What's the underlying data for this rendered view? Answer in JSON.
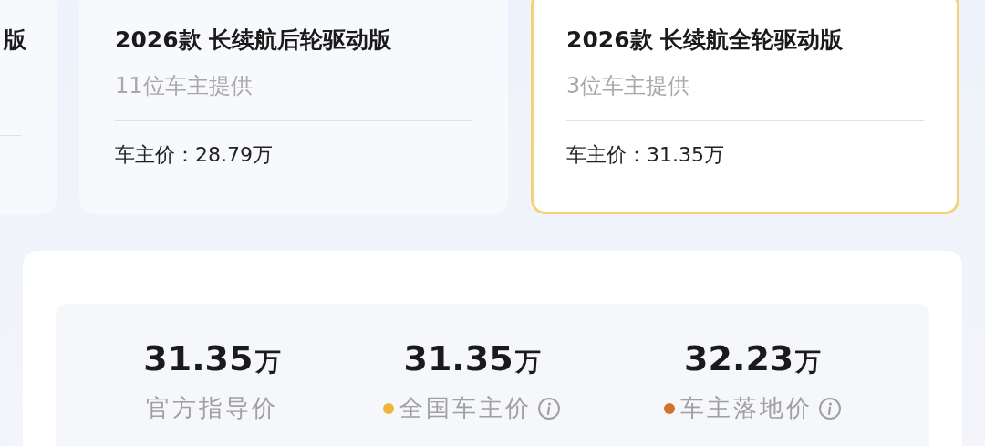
{
  "trims": [
    {
      "title": "版",
      "selected": false
    },
    {
      "title": "2026款 长续航后轮驱动版",
      "owners": "11位车主提供",
      "price_label": "车主价：",
      "price": "28.79万",
      "selected": false
    },
    {
      "title": "2026款 长续航全轮驱动版",
      "owners": "3位车主提供",
      "price_label": "车主价：",
      "price": "31.35万",
      "selected": true
    }
  ],
  "summary": [
    {
      "value": "31.35",
      "unit": "万",
      "label": "官方指导价"
    },
    {
      "value": "31.35",
      "unit": "万",
      "label": "全国车主价",
      "color": "#f0b43c",
      "info": true
    },
    {
      "value": "32.23",
      "unit": "万",
      "label": "车主落地价",
      "color": "#d2732d",
      "info": true
    }
  ]
}
